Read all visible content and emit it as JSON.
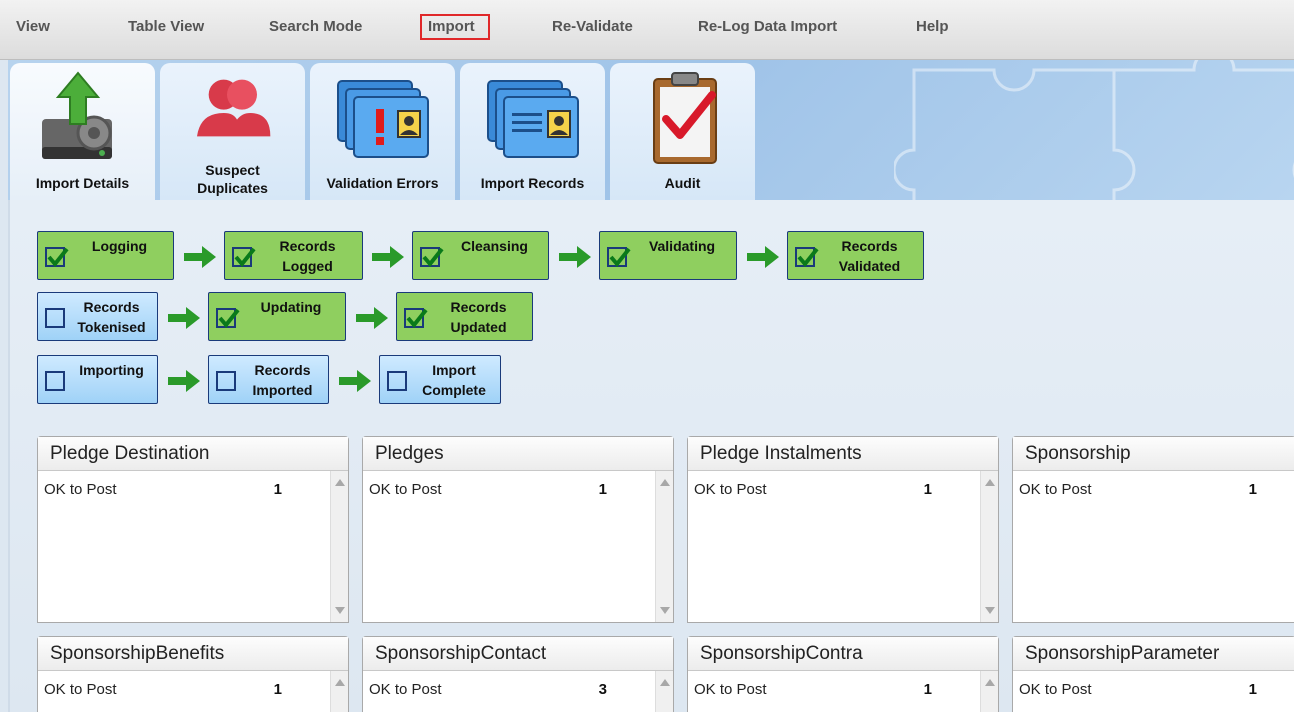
{
  "menu": {
    "view": "View",
    "table_view": "Table View",
    "search_mode": "Search Mode",
    "import": "Import",
    "revalidate": "Re-Validate",
    "relog": "Re-Log Data Import",
    "help": "Help"
  },
  "tabs": {
    "import_details": "Import Details",
    "suspect_duplicates_1": "Suspect",
    "suspect_duplicates_2": "Duplicates",
    "validation_errors": "Validation Errors",
    "import_records": "Import Records",
    "audit": "Audit"
  },
  "steps": {
    "logging": "Logging",
    "records_logged_1": "Records",
    "records_logged_2": "Logged",
    "cleansing": "Cleansing",
    "validating": "Validating",
    "records_validated_1": "Records",
    "records_validated_2": "Validated",
    "records_tokenised_1": "Records",
    "records_tokenised_2": "Tokenised",
    "updating": "Updating",
    "records_updated_1": "Records",
    "records_updated_2": "Updated",
    "importing": "Importing",
    "records_imported_1": "Records",
    "records_imported_2": "Imported",
    "import_complete_1": "Import",
    "import_complete_2": "Complete"
  },
  "panels": {
    "p1": {
      "title": "Pledge Destination",
      "status": "OK to Post",
      "count": "1"
    },
    "p2": {
      "title": "Pledges",
      "status": "OK to Post",
      "count": "1"
    },
    "p3": {
      "title": "Pledge Instalments",
      "status": "OK to Post",
      "count": "1"
    },
    "p4": {
      "title": "Sponsorship",
      "status": "OK to Post",
      "count": "1"
    },
    "p5": {
      "title": "SponsorshipBenefits",
      "status": "OK to Post",
      "count": "1"
    },
    "p6": {
      "title": "SponsorshipContact",
      "status": "OK to Post",
      "count": "3"
    },
    "p7": {
      "title": "SponsorshipContra",
      "status": "OK to Post",
      "count": "1"
    },
    "p8": {
      "title": "SponsorshipParameter",
      "status": "OK to Post",
      "count": "1"
    }
  },
  "colors": {
    "accent_highlight": "#e0282a",
    "step_done": "#8fcf5f",
    "step_todo": "#9fd2f7",
    "arrow_green": "#2a9a2a"
  },
  "icons": [
    "server-upload-icon",
    "people-icon",
    "folder-error-icon",
    "folder-records-icon",
    "clipboard-check-icon",
    "check-icon",
    "right-arrow-icon"
  ]
}
